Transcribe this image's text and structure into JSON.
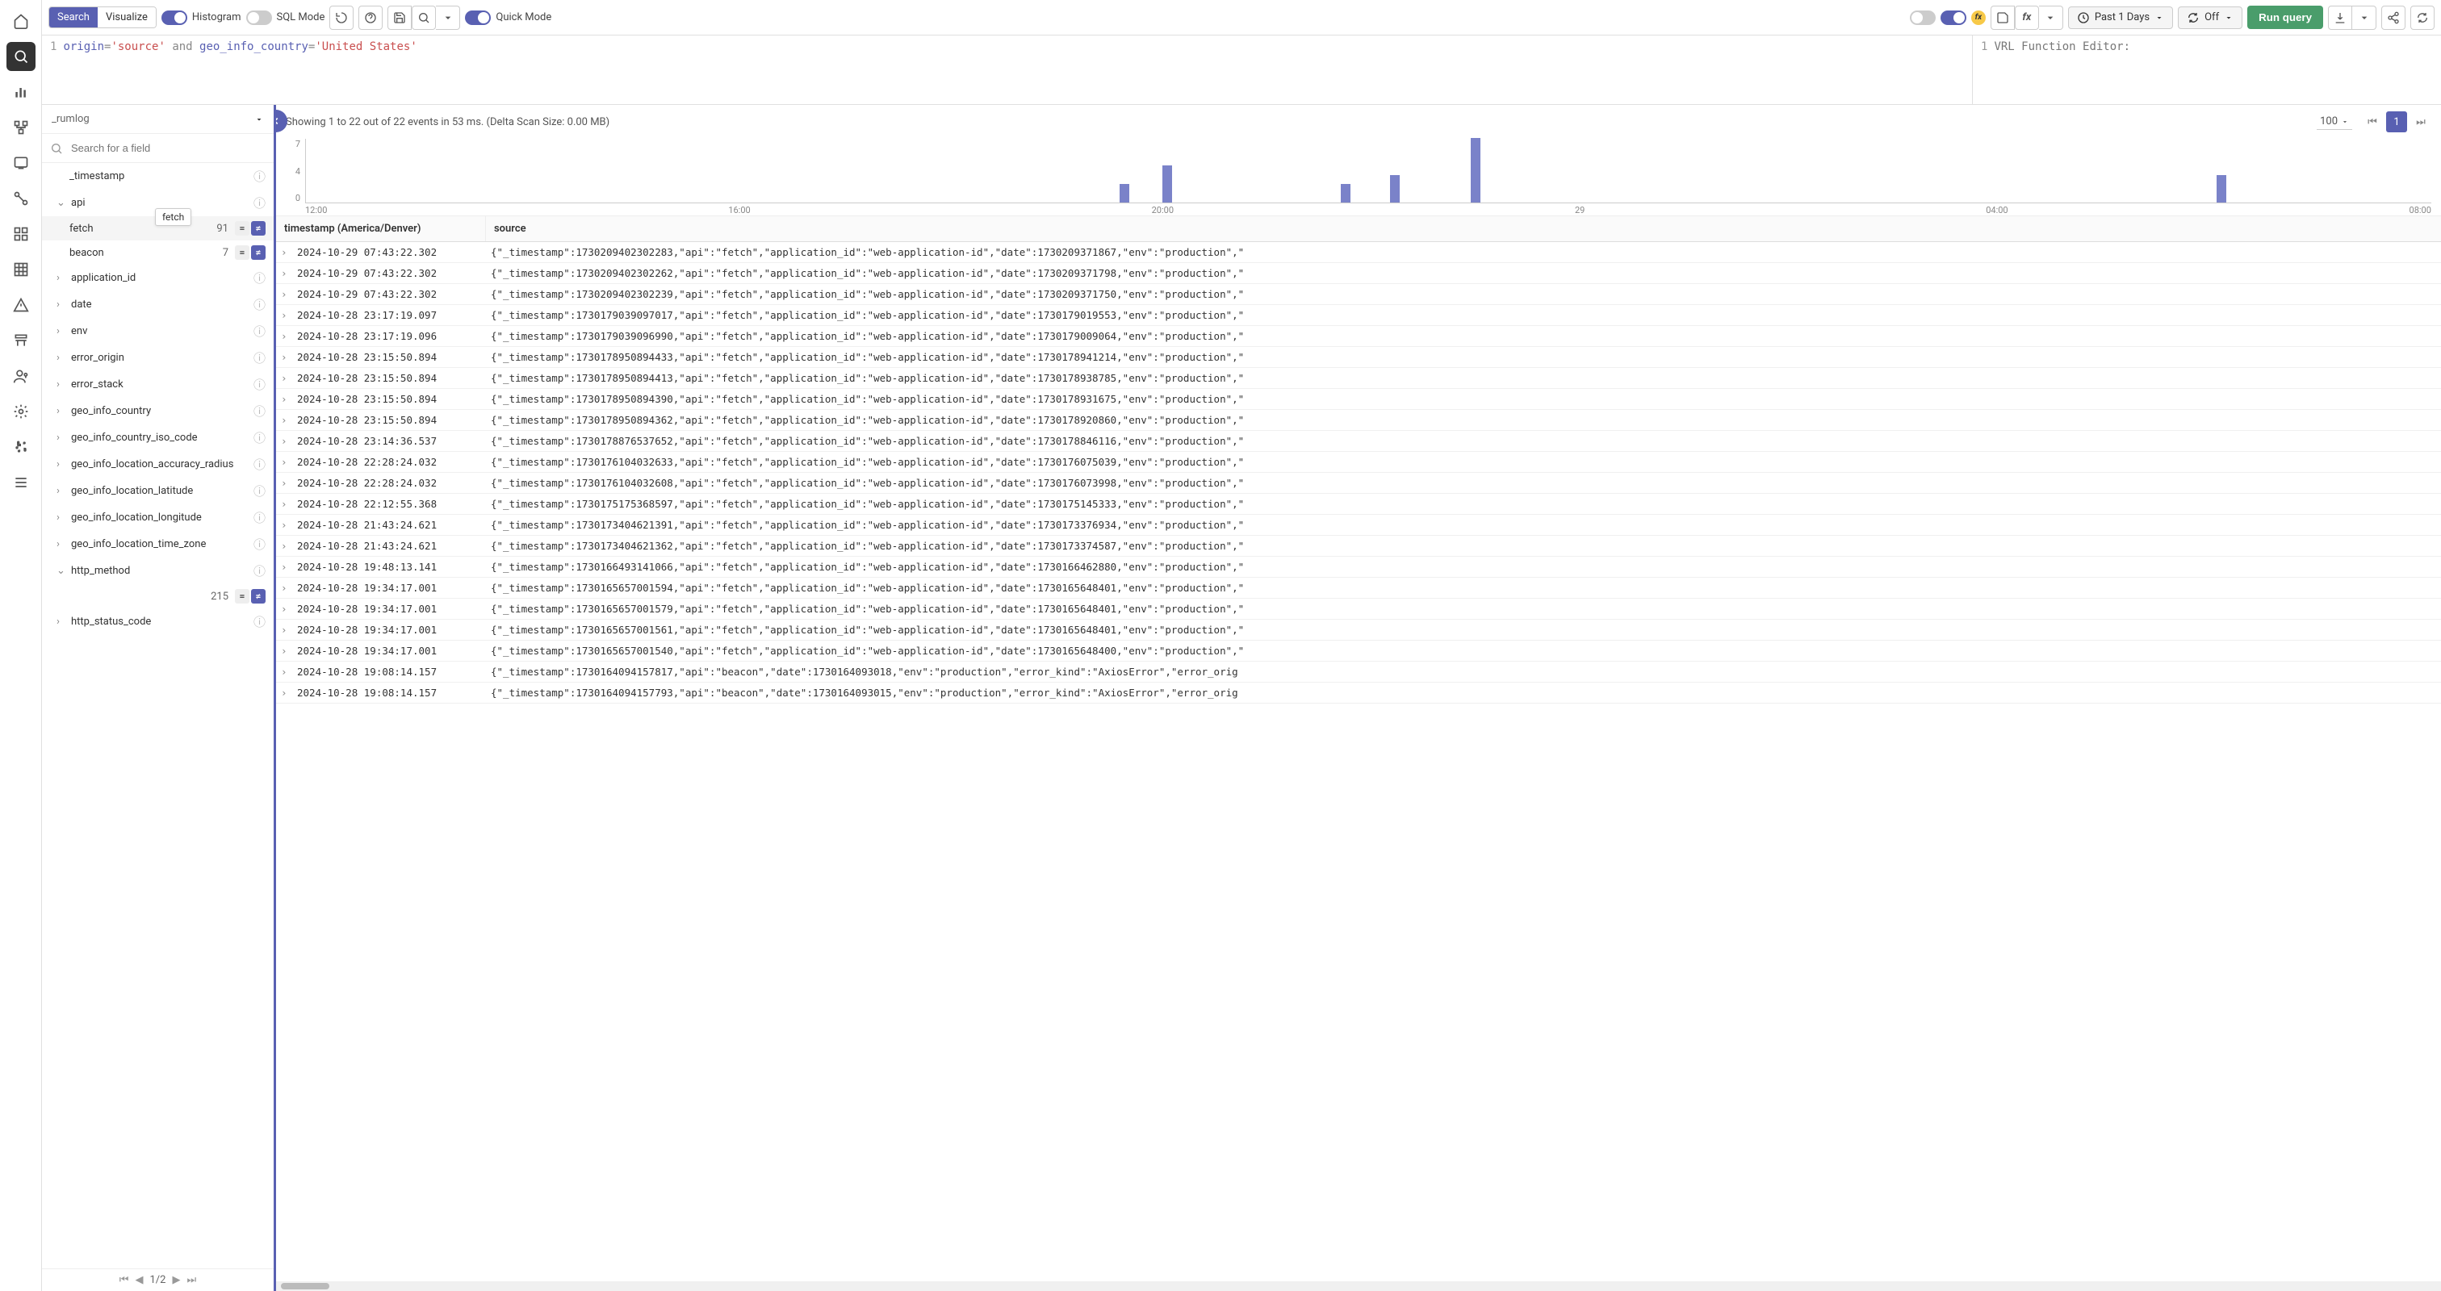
{
  "toolbar": {
    "tabs": {
      "search": "Search",
      "visualize": "Visualize"
    },
    "histogram_label": "Histogram",
    "sql_mode_label": "SQL Mode",
    "quick_mode_label": "Quick Mode",
    "time_range": "Past 1 Days",
    "refresh_label": "Off",
    "run_label": "Run query"
  },
  "query": {
    "line": "1",
    "parts": {
      "field1": "origin",
      "eq1": "=",
      "val1": "'source'",
      "and": " and ",
      "field2": "geo_info_country",
      "eq2": "=",
      "val2": "'United States'"
    }
  },
  "vrl": {
    "line": "1",
    "placeholder": "VRL Function Editor:"
  },
  "sidebar": {
    "stream": "_rumlog",
    "search_placeholder": "Search for a field",
    "fields": [
      {
        "name": "_timestamp",
        "leaf": true
      },
      {
        "name": "api",
        "expanded": true,
        "children": [
          {
            "name": "fetch",
            "count": "91",
            "hovered": true
          },
          {
            "name": "beacon",
            "count": "7"
          }
        ]
      },
      {
        "name": "application_id"
      },
      {
        "name": "date"
      },
      {
        "name": "env"
      },
      {
        "name": "error_origin"
      },
      {
        "name": "error_stack"
      },
      {
        "name": "geo_info_country"
      },
      {
        "name": "geo_info_country_iso_code"
      },
      {
        "name": "geo_info_location_accuracy_radius"
      },
      {
        "name": "geo_info_location_latitude"
      },
      {
        "name": "geo_info_location_longitude"
      },
      {
        "name": "geo_info_location_time_zone"
      },
      {
        "name": "http_method",
        "expanded": true,
        "children": [
          {
            "name": "",
            "count": "215"
          }
        ]
      },
      {
        "name": "http_status_code"
      }
    ],
    "tooltip": "fetch",
    "page": "1/2"
  },
  "results": {
    "status": "Showing 1 to 22 out of 22 events in 53 ms. (Delta Scan Size: 0.00 MB)",
    "page_size": "100",
    "current_page": "1",
    "columns": {
      "timestamp": "timestamp (America/Denver)",
      "source": "source"
    },
    "rows": [
      {
        "ts": "2024-10-29 07:43:22.302",
        "src": "{\"_timestamp\":1730209402302283,\"api\":\"fetch\",\"application_id\":\"web-application-id\",\"date\":1730209371867,\"env\":\"production\",\""
      },
      {
        "ts": "2024-10-29 07:43:22.302",
        "src": "{\"_timestamp\":1730209402302262,\"api\":\"fetch\",\"application_id\":\"web-application-id\",\"date\":1730209371798,\"env\":\"production\",\""
      },
      {
        "ts": "2024-10-29 07:43:22.302",
        "src": "{\"_timestamp\":1730209402302239,\"api\":\"fetch\",\"application_id\":\"web-application-id\",\"date\":1730209371750,\"env\":\"production\",\""
      },
      {
        "ts": "2024-10-28 23:17:19.097",
        "src": "{\"_timestamp\":1730179039097017,\"api\":\"fetch\",\"application_id\":\"web-application-id\",\"date\":1730179019553,\"env\":\"production\",\""
      },
      {
        "ts": "2024-10-28 23:17:19.096",
        "src": "{\"_timestamp\":1730179039096990,\"api\":\"fetch\",\"application_id\":\"web-application-id\",\"date\":1730179009064,\"env\":\"production\",\""
      },
      {
        "ts": "2024-10-28 23:15:50.894",
        "src": "{\"_timestamp\":1730178950894433,\"api\":\"fetch\",\"application_id\":\"web-application-id\",\"date\":1730178941214,\"env\":\"production\",\""
      },
      {
        "ts": "2024-10-28 23:15:50.894",
        "src": "{\"_timestamp\":1730178950894413,\"api\":\"fetch\",\"application_id\":\"web-application-id\",\"date\":1730178938785,\"env\":\"production\",\""
      },
      {
        "ts": "2024-10-28 23:15:50.894",
        "src": "{\"_timestamp\":1730178950894390,\"api\":\"fetch\",\"application_id\":\"web-application-id\",\"date\":1730178931675,\"env\":\"production\",\""
      },
      {
        "ts": "2024-10-28 23:15:50.894",
        "src": "{\"_timestamp\":1730178950894362,\"api\":\"fetch\",\"application_id\":\"web-application-id\",\"date\":1730178920860,\"env\":\"production\",\""
      },
      {
        "ts": "2024-10-28 23:14:36.537",
        "src": "{\"_timestamp\":1730178876537652,\"api\":\"fetch\",\"application_id\":\"web-application-id\",\"date\":1730178846116,\"env\":\"production\",\""
      },
      {
        "ts": "2024-10-28 22:28:24.032",
        "src": "{\"_timestamp\":1730176104032633,\"api\":\"fetch\",\"application_id\":\"web-application-id\",\"date\":1730176075039,\"env\":\"production\",\""
      },
      {
        "ts": "2024-10-28 22:28:24.032",
        "src": "{\"_timestamp\":1730176104032608,\"api\":\"fetch\",\"application_id\":\"web-application-id\",\"date\":1730176073998,\"env\":\"production\",\""
      },
      {
        "ts": "2024-10-28 22:12:55.368",
        "src": "{\"_timestamp\":1730175175368597,\"api\":\"fetch\",\"application_id\":\"web-application-id\",\"date\":1730175145333,\"env\":\"production\",\""
      },
      {
        "ts": "2024-10-28 21:43:24.621",
        "src": "{\"_timestamp\":1730173404621391,\"api\":\"fetch\",\"application_id\":\"web-application-id\",\"date\":1730173376934,\"env\":\"production\",\""
      },
      {
        "ts": "2024-10-28 21:43:24.621",
        "src": "{\"_timestamp\":1730173404621362,\"api\":\"fetch\",\"application_id\":\"web-application-id\",\"date\":1730173374587,\"env\":\"production\",\""
      },
      {
        "ts": "2024-10-28 19:48:13.141",
        "src": "{\"_timestamp\":1730166493141066,\"api\":\"fetch\",\"application_id\":\"web-application-id\",\"date\":1730166462880,\"env\":\"production\",\""
      },
      {
        "ts": "2024-10-28 19:34:17.001",
        "src": "{\"_timestamp\":1730165657001594,\"api\":\"fetch\",\"application_id\":\"web-application-id\",\"date\":1730165648401,\"env\":\"production\",\""
      },
      {
        "ts": "2024-10-28 19:34:17.001",
        "src": "{\"_timestamp\":1730165657001579,\"api\":\"fetch\",\"application_id\":\"web-application-id\",\"date\":1730165648401,\"env\":\"production\",\""
      },
      {
        "ts": "2024-10-28 19:34:17.001",
        "src": "{\"_timestamp\":1730165657001561,\"api\":\"fetch\",\"application_id\":\"web-application-id\",\"date\":1730165648401,\"env\":\"production\",\""
      },
      {
        "ts": "2024-10-28 19:34:17.001",
        "src": "{\"_timestamp\":1730165657001540,\"api\":\"fetch\",\"application_id\":\"web-application-id\",\"date\":1730165648400,\"env\":\"production\",\""
      },
      {
        "ts": "2024-10-28 19:08:14.157",
        "src": "{\"_timestamp\":1730164094157817,\"api\":\"beacon\",\"date\":1730164093018,\"env\":\"production\",\"error_kind\":\"AxiosError\",\"error_orig"
      },
      {
        "ts": "2024-10-28 19:08:14.157",
        "src": "{\"_timestamp\":1730164094157793,\"api\":\"beacon\",\"date\":1730164093015,\"env\":\"production\",\"error_kind\":\"AxiosError\",\"error_orig"
      }
    ]
  },
  "chart_data": {
    "type": "bar",
    "title": "",
    "xlabel": "",
    "ylabel": "",
    "ylim": [
      0,
      7
    ],
    "y_ticks": [
      "7",
      "4",
      "0"
    ],
    "x_ticks": [
      "12:00",
      "16:00",
      "20:00",
      "29",
      "04:00",
      "08:00"
    ],
    "bars": [
      {
        "x_pct": 38.3,
        "value": 2
      },
      {
        "x_pct": 40.3,
        "value": 4
      },
      {
        "x_pct": 48.7,
        "value": 2
      },
      {
        "x_pct": 51.0,
        "value": 3
      },
      {
        "x_pct": 54.8,
        "value": 7
      },
      {
        "x_pct": 89.9,
        "value": 3
      }
    ]
  }
}
